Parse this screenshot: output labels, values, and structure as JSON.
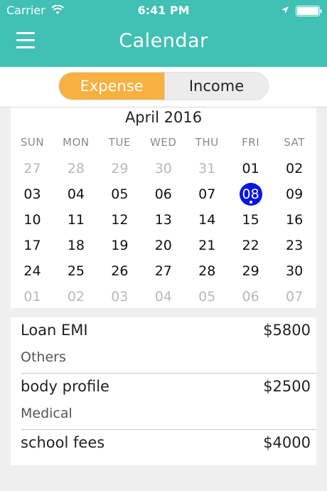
{
  "status_bar": {
    "carrier": "Carrier",
    "time": "6:41 PM"
  },
  "nav": {
    "title": "Calendar",
    "menu_icon": "hamburger-menu-icon"
  },
  "segment": {
    "expense_label": "Expense",
    "income_label": "Income",
    "selected": "Expense"
  },
  "calendar": {
    "month_label": "April 2016",
    "weekdays": [
      "SUN",
      "MON",
      "TUE",
      "WED",
      "THU",
      "FRI",
      "SAT"
    ],
    "weeks": [
      [
        "27",
        "28",
        "29",
        "30",
        "31",
        "01",
        "02"
      ],
      [
        "03",
        "04",
        "05",
        "06",
        "07",
        "08",
        "09"
      ],
      [
        "10",
        "11",
        "12",
        "13",
        "14",
        "15",
        "16"
      ],
      [
        "17",
        "18",
        "19",
        "20",
        "21",
        "22",
        "23"
      ],
      [
        "24",
        "25",
        "26",
        "27",
        "28",
        "29",
        "30"
      ],
      [
        "01",
        "02",
        "03",
        "04",
        "05",
        "06",
        "07"
      ]
    ],
    "selected_day": "08"
  },
  "transactions": [
    {
      "title": "Loan EMI",
      "amount": "$5800",
      "category": "Others"
    },
    {
      "title": "body profile",
      "amount": "$2500",
      "category": "Medical"
    },
    {
      "title": "school fees",
      "amount": "$4000",
      "category": ""
    }
  ],
  "colors": {
    "header": "#41c0b4",
    "expense_accent": "#f8b03e",
    "selected_day": "#0a14e6"
  }
}
